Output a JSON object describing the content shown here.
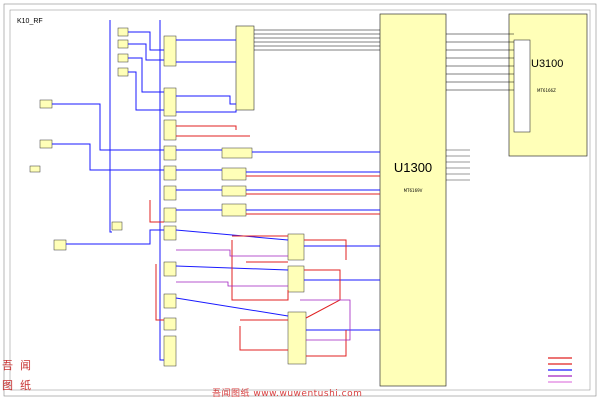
{
  "sheet": {
    "title": "K10_RF"
  },
  "components": {
    "u1300": {
      "ref": "U1300",
      "part": "MT6169V"
    },
    "u3100": {
      "ref": "U3100",
      "part": "MT6166Z"
    }
  },
  "watermark": {
    "text": "吾闻图纸 www.wuwentushi.com",
    "seal_chars": [
      "吾",
      "闻",
      "图",
      "纸"
    ]
  },
  "colors": {
    "wire_blue": "#1a1aff",
    "wire_red": "#e02020",
    "wire_purple": "#a020c0",
    "wire_black": "#000000",
    "ic_fill": "#ffffb8",
    "seal_red": "#c83232"
  },
  "legend": {
    "items": [
      {
        "color": "#e02020"
      },
      {
        "color": "#e02020"
      },
      {
        "color": "#1a1aff"
      },
      {
        "color": "#a020c0"
      },
      {
        "color": "#e080e0"
      }
    ]
  }
}
